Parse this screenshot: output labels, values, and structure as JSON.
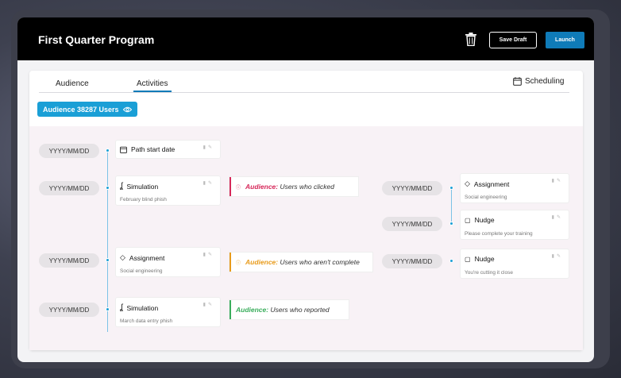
{
  "header": {
    "title": "First Quarter Program",
    "save_label": "Save Draft",
    "launch_label": "Launch"
  },
  "tabs": [
    {
      "label": "Audience",
      "active": false
    },
    {
      "label": "Activities",
      "active": true
    }
  ],
  "scheduling_label": "Scheduling",
  "audience_pill": "Audience 38287 Users",
  "colors": {
    "accent": "#0f7bb8",
    "pill": "#1a9fd6",
    "clicked": "#d6285a",
    "not_complete": "#e89b1b",
    "reported": "#3aad5c"
  },
  "dates": {
    "d1": "YYYY/MM/DD",
    "d2": "YYYY/MM/DD",
    "d3": "YYYY/MM/DD",
    "d4": "YYYY/MM/DD",
    "r1": "YYYY/MM/DD",
    "r2": "YYYY/MM/DD",
    "r3": "YYYY/MM/DD"
  },
  "steps": {
    "path_start": {
      "title": "Path start date",
      "icon": "calendar-icon"
    },
    "sim1": {
      "title": "Simulation",
      "sub": "February blind phish",
      "icon": "hook-icon"
    },
    "assign1": {
      "title": "Assignment",
      "sub": "Social engineering",
      "icon": "graduation-cap-icon"
    },
    "sim2": {
      "title": "Simulation",
      "sub": "March data entry phish",
      "icon": "hook-icon"
    },
    "r_assign": {
      "title": "Assignment",
      "sub": "Social engineering",
      "icon": "graduation-cap-icon"
    },
    "r_nudge1": {
      "title": "Nudge",
      "sub": "Please complete your training",
      "icon": "nudge-icon"
    },
    "r_nudge2": {
      "title": "Nudge",
      "sub": "You're cutting it close",
      "icon": "nudge-icon"
    }
  },
  "audiences": {
    "clicked": {
      "label": "Audience:",
      "text": "Users who clicked"
    },
    "not_complete": {
      "label": "Audience:",
      "text": "Users who aren't complete"
    },
    "reported": {
      "label": "Audience:",
      "text": "Users who reported"
    }
  }
}
